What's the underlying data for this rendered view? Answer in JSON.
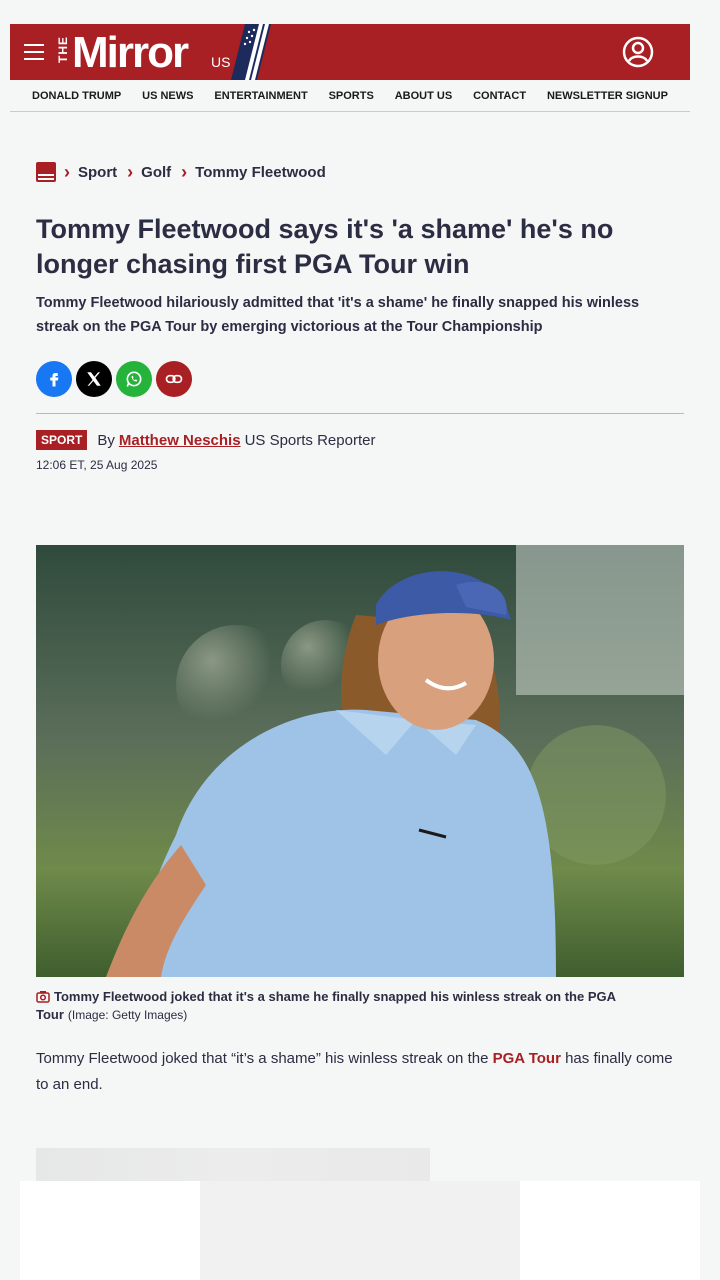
{
  "masthead": {
    "logo_the": "THE",
    "logo_mirror": "Mirror",
    "logo_us": "US",
    "brand_color": "#a81f24"
  },
  "nav": {
    "items": [
      "DONALD TRUMP",
      "US NEWS",
      "ENTERTAINMENT",
      "SPORTS",
      "ABOUT US",
      "CONTACT",
      "NEWSLETTER SIGNUP"
    ]
  },
  "breadcrumb": {
    "items": [
      "Sport",
      "Golf",
      "Tommy Fleetwood"
    ]
  },
  "article": {
    "headline": "Tommy Fleetwood says it's 'a shame' he's no longer chasing first PGA Tour win",
    "standfirst": "Tommy Fleetwood hilariously admitted that 'it's a shame' he finally snapped his winless streak on the PGA Tour by emerging victorious at the Tour Championship",
    "section_badge": "SPORT",
    "by": "By",
    "author": "Matthew Neschis",
    "author_role": "US Sports Reporter",
    "timestamp": "12:06 ET, 25 Aug 2025",
    "caption": "Tommy Fleetwood joked that it's a shame he finally snapped his winless streak on the PGA Tour",
    "caption_credit": "(Image: Getty Images)",
    "body_before": "Tommy Fleetwood joked that “it’s a shame” his winless streak on the ",
    "body_link": "PGA Tour",
    "body_after": " has finally come to an end."
  },
  "icons": {
    "menu": "hamburger-icon",
    "account": "user-account-icon",
    "share": [
      "facebook-icon",
      "x-icon",
      "whatsapp-icon",
      "link-icon"
    ],
    "caption": "camera-icon"
  }
}
